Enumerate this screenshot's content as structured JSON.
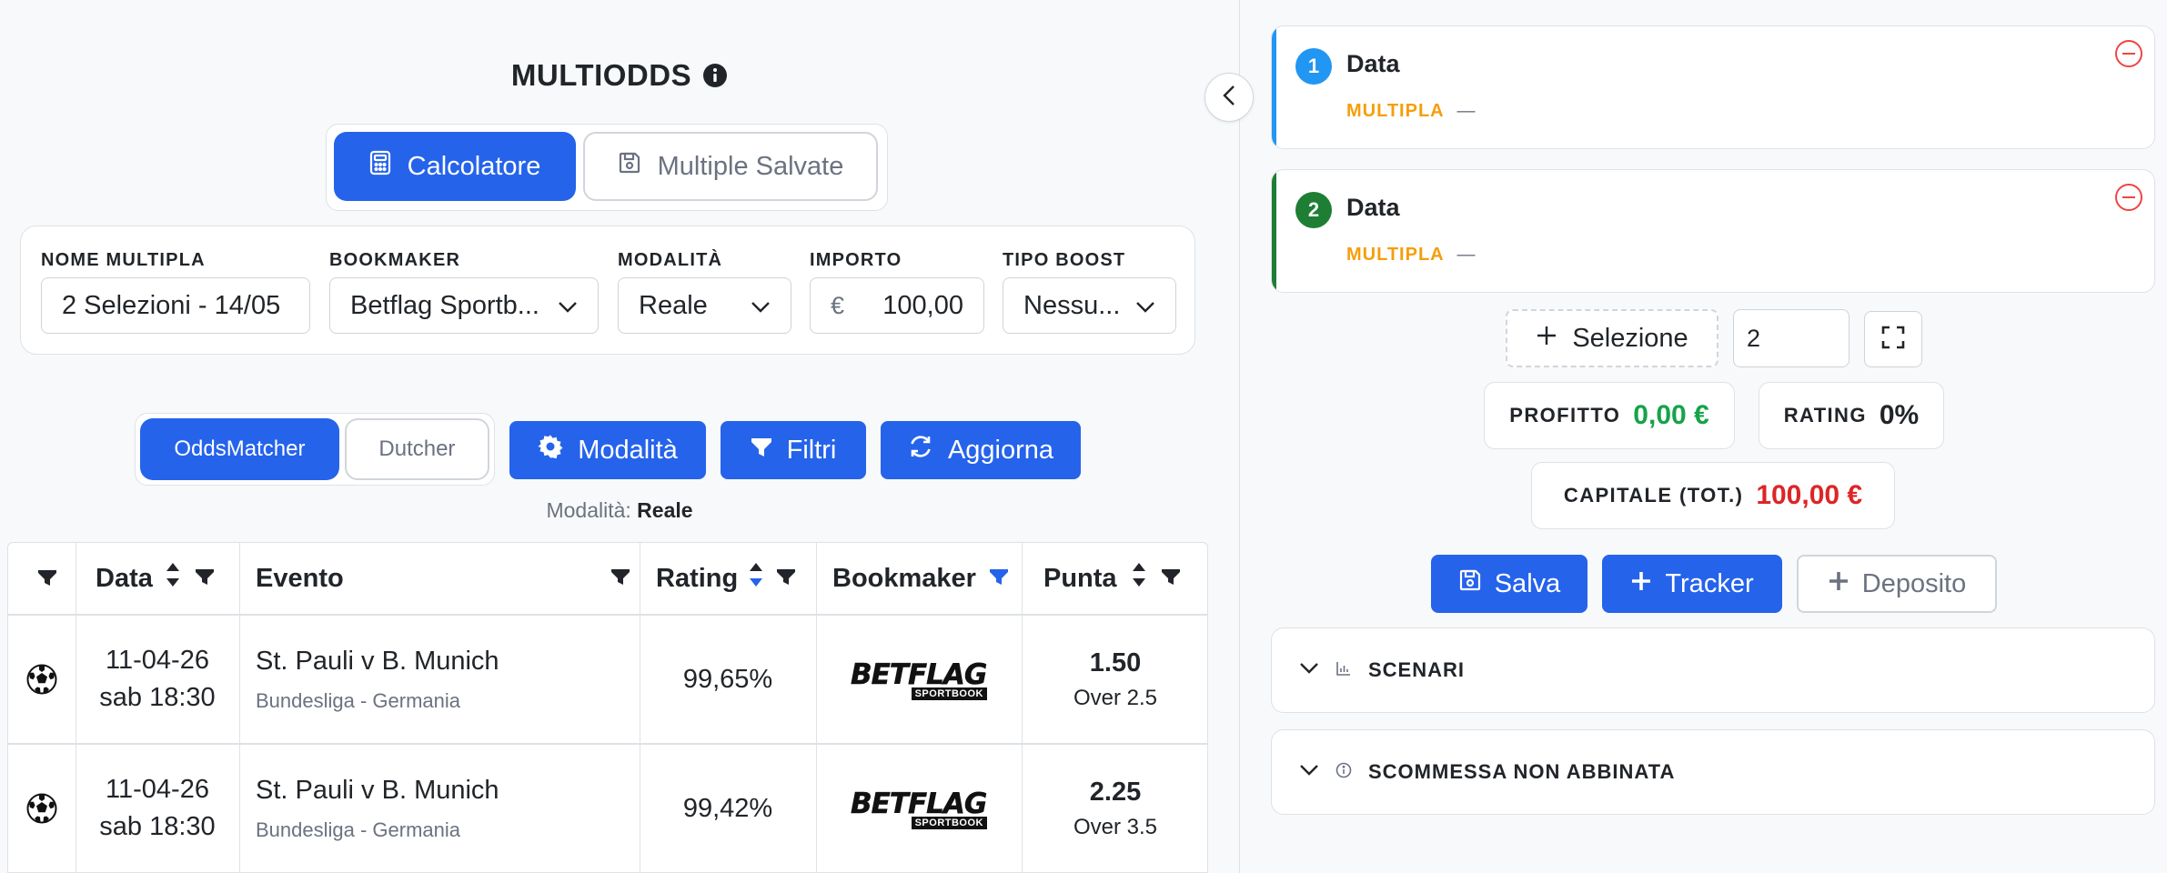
{
  "header": {
    "title": "MULTIODDS"
  },
  "main_tabs": [
    {
      "label": "Calcolatore",
      "icon": "calculator-icon"
    },
    {
      "label": "Multiple Salvate",
      "icon": "save-icon"
    }
  ],
  "form": {
    "name_label": "NOME MULTIPLA",
    "name_value": "2 Selezioni - 14/05",
    "bookmaker_label": "BOOKMAKER",
    "bookmaker_value": "Betflag Sportb...",
    "mode_label": "MODALITÀ",
    "mode_value": "Reale",
    "amount_label": "IMPORTO",
    "amount_currency": "€",
    "amount_value": "100,00",
    "boost_label": "TIPO BOOST",
    "boost_value": "Nessu..."
  },
  "toolbar": {
    "toggle_active": "OddsMatcher",
    "toggle_other": "Dutcher",
    "mode_btn": "Modalità",
    "filter_btn": "Filtri",
    "refresh_btn": "Aggiorna",
    "mode_prefix": "Modalità:",
    "mode_current": "Reale"
  },
  "table": {
    "headers": [
      "Data",
      "Evento",
      "Rating",
      "Bookmaker",
      "Punta"
    ],
    "rows": [
      {
        "sport": "soccer-ball-icon",
        "date": "11-04-26",
        "time": "sab 18:30",
        "event": "St. Pauli v B. Munich",
        "league": "Bundesliga - Germania",
        "rating": "99,65%",
        "bookmaker_logo": "BETFLAG",
        "bookmaker_sub": "SPORTBOOK",
        "odds": "1.50",
        "market": "Over 2.5"
      },
      {
        "sport": "soccer-ball-icon",
        "date": "11-04-26",
        "time": "sab 18:30",
        "event": "St. Pauli v B. Munich",
        "league": "Bundesliga - Germania",
        "rating": "99,42%",
        "bookmaker_logo": "BETFLAG",
        "bookmaker_sub": "SPORTBOOK",
        "odds": "2.25",
        "market": "Over 3.5"
      }
    ]
  },
  "selections": [
    {
      "number": "1",
      "title": "Data",
      "subtitle": "MULTIPLA",
      "dash": "—",
      "color": "#2196f3"
    },
    {
      "number": "2",
      "title": "Data",
      "subtitle": "MULTIPLA",
      "dash": "—",
      "color": "#1e7e34"
    }
  ],
  "controls": {
    "add_selection": "Selezione",
    "count_value": "2"
  },
  "stats": {
    "profit_label": "PROFITTO",
    "profit_value": "0,00 €",
    "rating_label": "RATING",
    "rating_value": "0%",
    "capital_label": "CAPITALE (TOT.)",
    "capital_value": "100,00 €"
  },
  "actions": {
    "save": "Salva",
    "tracker": "Tracker",
    "deposit": "Deposito"
  },
  "accordions": [
    {
      "title": "SCENARI",
      "icon": "bar-chart-icon"
    },
    {
      "title": "SCOMMESSA NON ABBINATA",
      "icon": "info-circle-icon"
    }
  ],
  "colors": {
    "primary": "#2563eb",
    "profit": "#16a34a",
    "capital": "#dc2626",
    "multipla": "#f59e0b",
    "remove": "#ef4444"
  }
}
